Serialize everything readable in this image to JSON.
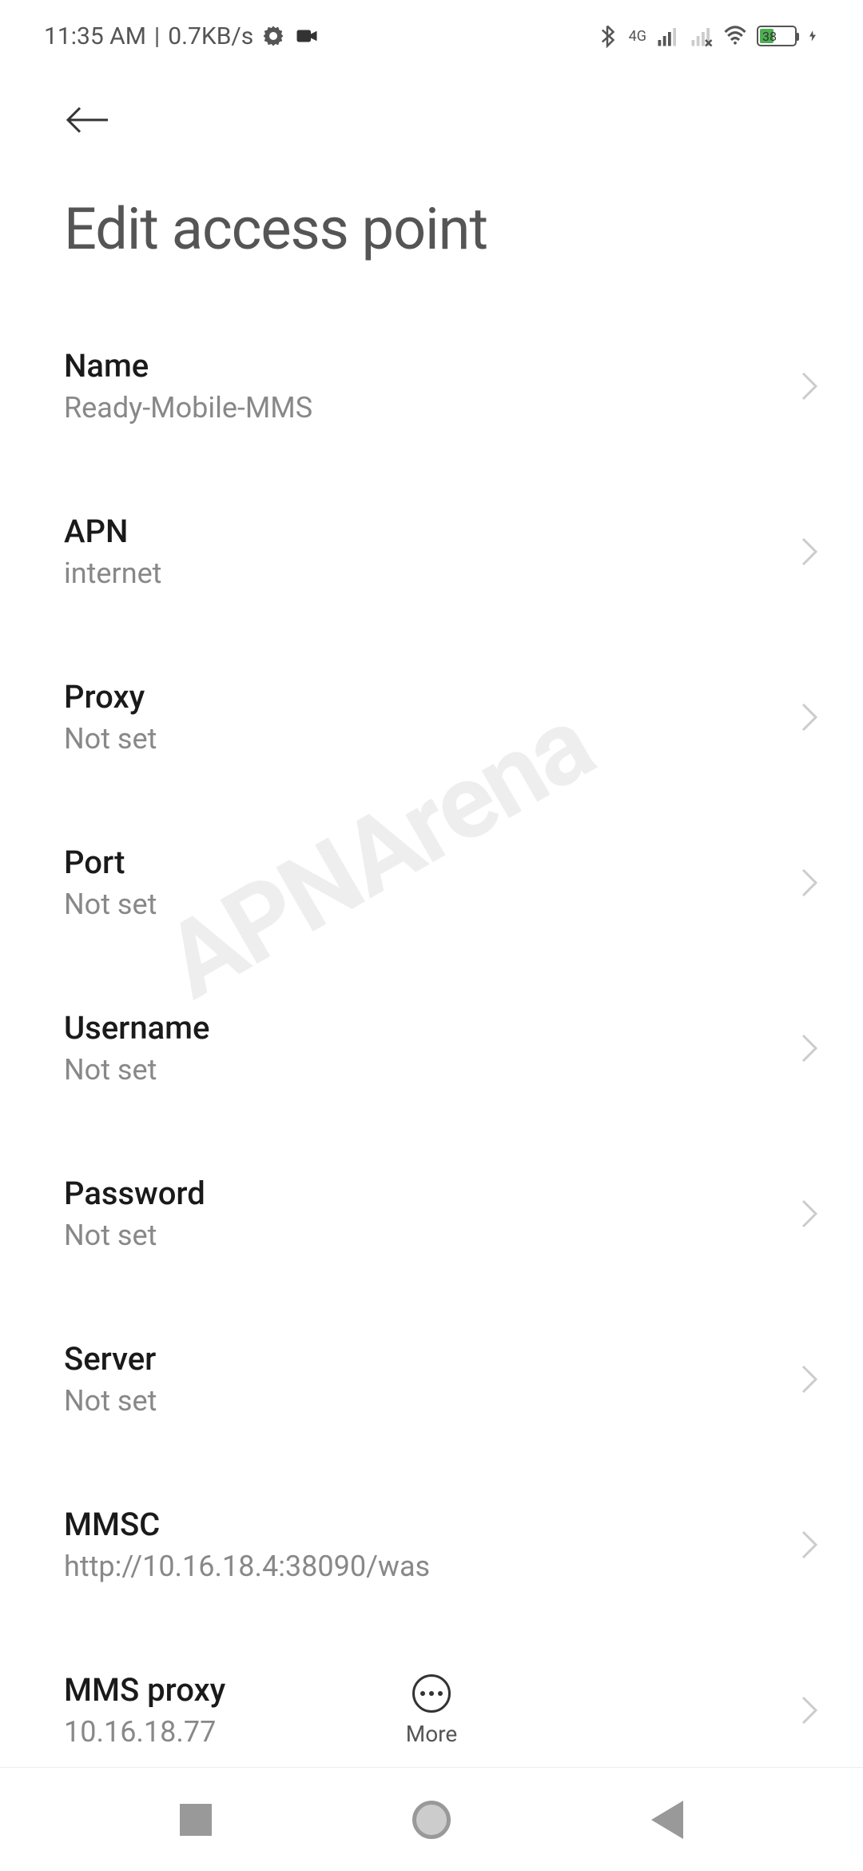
{
  "status_bar": {
    "time": "11:35 AM",
    "speed": "0.7KB/s",
    "network_label": "4G",
    "battery_percent": "38"
  },
  "page": {
    "title": "Edit access point"
  },
  "settings": [
    {
      "title": "Name",
      "value": "Ready-Mobile-MMS",
      "key": "name"
    },
    {
      "title": "APN",
      "value": "internet",
      "key": "apn"
    },
    {
      "title": "Proxy",
      "value": "Not set",
      "key": "proxy"
    },
    {
      "title": "Port",
      "value": "Not set",
      "key": "port"
    },
    {
      "title": "Username",
      "value": "Not set",
      "key": "username"
    },
    {
      "title": "Password",
      "value": "Not set",
      "key": "password"
    },
    {
      "title": "Server",
      "value": "Not set",
      "key": "server"
    },
    {
      "title": "MMSC",
      "value": "http://10.16.18.4:38090/was",
      "key": "mmsc"
    },
    {
      "title": "MMS proxy",
      "value": "10.16.18.77",
      "key": "mms-proxy"
    }
  ],
  "bottom": {
    "more_label": "More"
  },
  "watermark": "APNArena"
}
